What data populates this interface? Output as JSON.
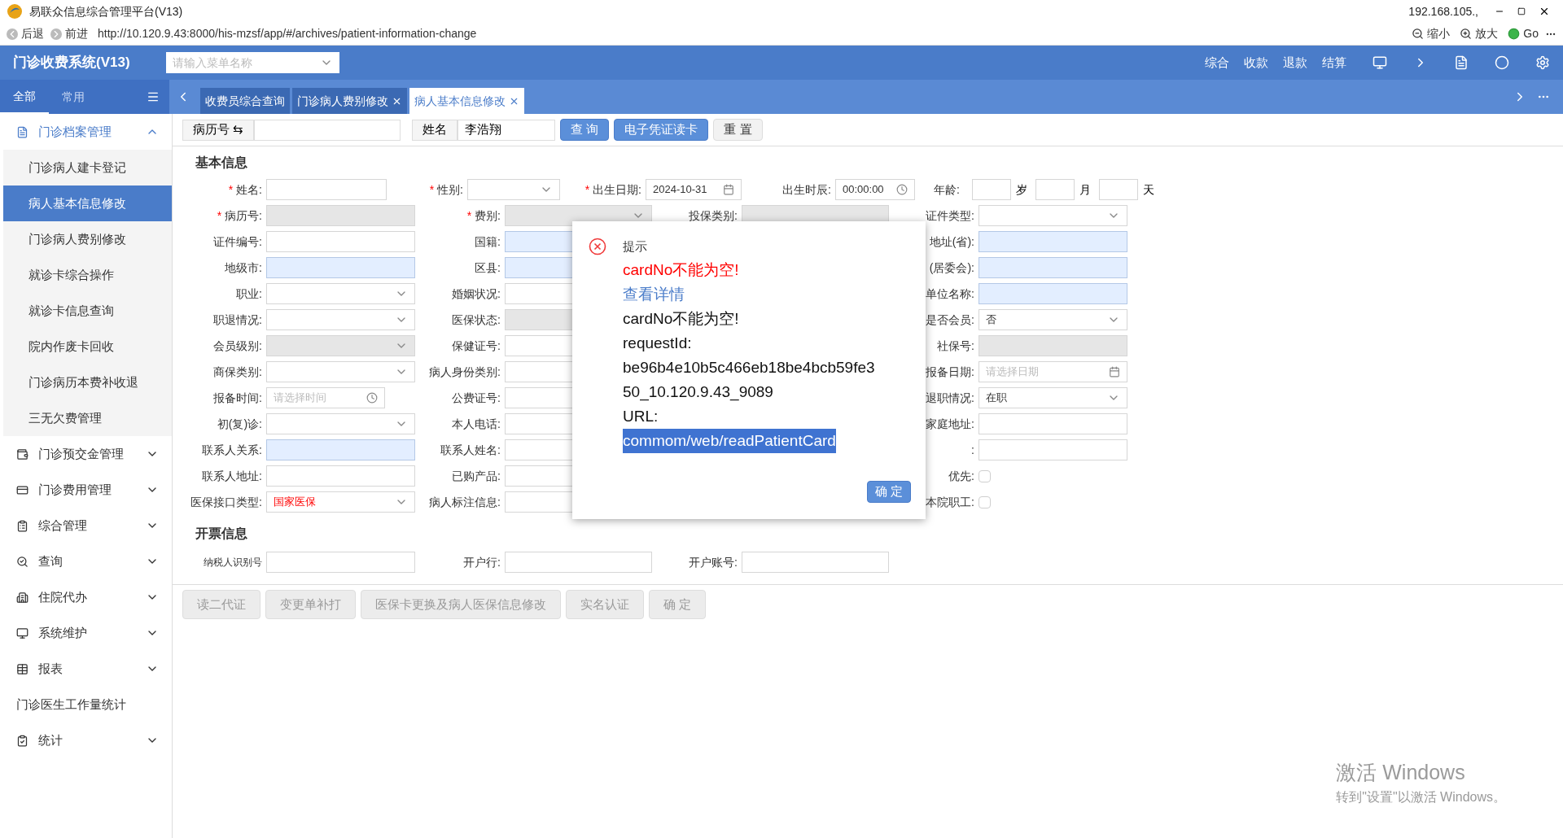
{
  "window": {
    "title": "易联众信息综合管理平台(V13)",
    "address": "192.168.105.,"
  },
  "browser": {
    "back": "后退",
    "forward": "前进",
    "url": "http://10.120.9.43:8000/his-mzsf/app/#/archives/patient-information-change",
    "zoom_out": "缩小",
    "zoom_in": "放大",
    "go": "Go"
  },
  "header": {
    "app_title": "门诊收费系统(V13)",
    "menu_search": {
      "placeholder": "请输入菜单名称"
    },
    "nav": [
      "综合",
      "收款",
      "退款",
      "结算"
    ]
  },
  "sidebar": {
    "tabs": [
      {
        "label": "全部",
        "selected": true
      },
      {
        "label": "常用",
        "selected": false
      }
    ],
    "items": [
      {
        "label": "门诊档案管理",
        "expanded": true,
        "children": [
          {
            "label": "门诊病人建卡登记",
            "selected": false
          },
          {
            "label": "病人基本信息修改",
            "selected": true
          },
          {
            "label": "门诊病人费别修改",
            "selected": false
          },
          {
            "label": "就诊卡综合操作",
            "selected": false
          },
          {
            "label": "就诊卡信息查询",
            "selected": false
          },
          {
            "label": "院内作废卡回收",
            "selected": false
          },
          {
            "label": "门诊病历本费补收退",
            "selected": false
          },
          {
            "label": "三无欠费管理",
            "selected": false
          }
        ]
      },
      {
        "label": "门诊预交金管理",
        "expanded": false
      },
      {
        "label": "门诊费用管理",
        "expanded": false
      },
      {
        "label": "综合管理",
        "expanded": false
      },
      {
        "label": "查询",
        "expanded": false
      },
      {
        "label": "住院代办",
        "expanded": false
      },
      {
        "label": "系统维护",
        "expanded": false
      },
      {
        "label": "报表",
        "expanded": false
      },
      {
        "label": "门诊医生工作量统计",
        "kind": "link"
      },
      {
        "label": "统计",
        "expanded": false
      }
    ]
  },
  "tabs": [
    {
      "label": "收费员综合查询",
      "selected": false,
      "closable": false
    },
    {
      "label": "门诊病人费别修改",
      "selected": false,
      "closable": true
    },
    {
      "label": "病人基本信息修改",
      "selected": true,
      "closable": true
    }
  ],
  "search_bar": {
    "record_label": "病历号 ⇆",
    "name_label": "姓名",
    "name_value": "李浩翔",
    "buttons": [
      {
        "label": "查 询",
        "primary": true
      },
      {
        "label": "电子凭证读卡",
        "primary": true
      },
      {
        "label": "重 置",
        "primary": false
      }
    ]
  },
  "basic_info": {
    "title": "基本信息",
    "first_row": {
      "name": {
        "label": "姓名:",
        "marker": "*"
      },
      "gender": {
        "label": "性别:",
        "marker": "*"
      },
      "birth_date": {
        "label": "出生日期:",
        "marker": "*",
        "value": "2024-10-31"
      },
      "birth_time": {
        "label": "出生时辰:",
        "value": "00:00:00"
      },
      "age": {
        "label": "年龄:",
        "units": [
          "岁",
          "月",
          "天"
        ]
      }
    },
    "rows": [
      [
        {
          "label": "病历号:",
          "marker": "*",
          "kind": "input",
          "readonly": true,
          "highlighted": false
        },
        {
          "label": "费别:",
          "marker": "*",
          "kind": "select",
          "readonly": true,
          "highlighted": false
        },
        {
          "label": "投保类别:",
          "kind": "input",
          "readonly": true,
          "highlighted": false
        },
        {
          "label": "证件类型:",
          "kind": "select",
          "readonly": false,
          "highlighted": false
        }
      ],
      [
        {
          "label": "证件编号:",
          "kind": "input",
          "readonly": false,
          "highlighted": false
        },
        {
          "label": "国籍:",
          "kind": "input",
          "readonly": false,
          "highlighted": true
        },
        null,
        {
          "label": "地址(省):",
          "kind": "input",
          "readonly": false,
          "highlighted": true
        }
      ],
      [
        {
          "label": "地级市:",
          "kind": "input",
          "readonly": false,
          "highlighted": true
        },
        {
          "label": "区县:",
          "kind": "input",
          "readonly": false,
          "highlighted": true
        },
        null,
        {
          "label": "(居委会):",
          "kind": "input",
          "readonly": false,
          "highlighted": true
        }
      ],
      [
        {
          "label": "职业:",
          "kind": "select",
          "readonly": false,
          "highlighted": false
        },
        {
          "label": "婚姻状况:",
          "kind": "input",
          "readonly": false,
          "highlighted": false
        },
        null,
        {
          "label": "单位名称:",
          "kind": "input",
          "readonly": false,
          "highlighted": true
        }
      ],
      [
        {
          "label": "职退情况:",
          "kind": "select",
          "readonly": false,
          "highlighted": false
        },
        {
          "label": "医保状态:",
          "kind": "input",
          "readonly": true,
          "highlighted": false
        },
        null,
        {
          "label": "是否会员:",
          "kind": "select",
          "readonly": false,
          "highlighted": false,
          "value": "否"
        }
      ],
      [
        {
          "label": "会员级别:",
          "kind": "select",
          "readonly": true,
          "highlighted": false
        },
        {
          "label": "保健证号:",
          "kind": "input",
          "readonly": false,
          "highlighted": false
        },
        null,
        {
          "label": "社保号:",
          "kind": "input",
          "readonly": true,
          "highlighted": false
        }
      ],
      [
        {
          "label": "商保类别:",
          "kind": "select",
          "readonly": false,
          "highlighted": false
        },
        {
          "label": "病人身份类别:",
          "kind": "input",
          "readonly": false,
          "highlighted": false
        },
        null,
        {
          "label": "报备日期:",
          "kind": "date",
          "readonly": false,
          "highlighted": false,
          "placeholder": "请选择日期"
        }
      ],
      [
        {
          "label": "报备时间:",
          "kind": "time",
          "readonly": false,
          "highlighted": false,
          "placeholder": "请选择时间"
        },
        {
          "label": "公费证号:",
          "kind": "input",
          "readonly": false,
          "highlighted": false
        },
        null,
        {
          "label": "退职情况:",
          "kind": "select",
          "readonly": false,
          "highlighted": false,
          "value": "在职"
        }
      ],
      [
        {
          "label": "初(复)诊:",
          "kind": "select",
          "readonly": false,
          "highlighted": false
        },
        {
          "label": "本人电话:",
          "kind": "input",
          "readonly": false,
          "highlighted": false
        },
        null,
        {
          "label": "家庭地址:",
          "kind": "input",
          "readonly": false,
          "highlighted": false
        }
      ],
      [
        {
          "label": "联系人关系:",
          "kind": "input",
          "readonly": false,
          "highlighted": true
        },
        {
          "label": "联系人姓名:",
          "kind": "input",
          "readonly": false,
          "highlighted": false
        },
        null,
        {
          "label": ":",
          "kind": "input",
          "readonly": false,
          "highlighted": false
        }
      ],
      [
        {
          "label": "联系人地址:",
          "kind": "input",
          "readonly": false,
          "highlighted": false
        },
        {
          "label": "已购产品:",
          "kind": "input",
          "readonly": false,
          "highlighted": false
        },
        null,
        {
          "label": "优先:",
          "kind": "checkbox",
          "checked": false
        }
      ],
      [
        {
          "label": "医保接口类型:",
          "kind": "select",
          "readonly": false,
          "highlighted": false,
          "value": "国家医保",
          "alert": true
        },
        {
          "label": "病人标注信息:",
          "kind": "input",
          "readonly": false,
          "highlighted": false
        },
        null,
        {
          "label": "本院职工:",
          "kind": "checkbox",
          "checked": false
        }
      ]
    ]
  },
  "invoice_info": {
    "title": "开票信息",
    "fields": [
      {
        "label": "纳税人识别号"
      },
      {
        "label": "开户行:"
      },
      {
        "label": "开户账号:"
      }
    ]
  },
  "actions": [
    {
      "label": "读二代证",
      "disabled": true
    },
    {
      "label": "变更单补打",
      "disabled": true
    },
    {
      "label": "医保卡更换及病人医保信息修改",
      "disabled": true
    },
    {
      "label": "实名认证",
      "disabled": true
    },
    {
      "label": "确 定",
      "disabled": true
    }
  ],
  "dialog": {
    "title": "提示",
    "error": "cardNo不能为空!",
    "link": "查看详情",
    "details": [
      "cardNo不能为空!",
      "requestId:",
      "be96b4e10b5c466eb18be4bcb59fe3",
      "50_10.120.9.43_9089",
      "URL:"
    ],
    "selected_text": "commom/web/readPatientCard",
    "button": "确 定"
  },
  "os_notice": {
    "title": "激活 Windows",
    "subtitle": "转到\"设置\"以激活 Windows。"
  }
}
